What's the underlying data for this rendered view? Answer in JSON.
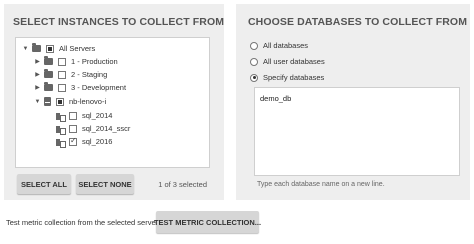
{
  "left_panel": {
    "title": "SELECT INSTANCES TO COLLECT FROM",
    "tree": [
      {
        "label": "All Servers",
        "toggle": "▼",
        "icon": "folder-icon",
        "check": "partial"
      },
      {
        "label": "1 - Production",
        "toggle": "▶",
        "icon": "folder-icon",
        "check": "unchecked"
      },
      {
        "label": "2 - Staging",
        "toggle": "▶",
        "icon": "folder-icon",
        "check": "unchecked"
      },
      {
        "label": "3 - Development",
        "toggle": "▶",
        "icon": "folder-icon",
        "check": "unchecked"
      },
      {
        "label": "nb-lenovo-i",
        "toggle": "▼",
        "icon": "server-icon",
        "check": "partial"
      },
      {
        "label": "sql_2014",
        "toggle": "",
        "icon": "database-icon",
        "check": "unchecked"
      },
      {
        "label": "sql_2014_sscr",
        "toggle": "",
        "icon": "database-icon",
        "check": "unchecked"
      },
      {
        "label": "sql_2016",
        "toggle": "",
        "icon": "database-icon",
        "check": "checked"
      }
    ],
    "select_all_label": "SELECT ALL",
    "select_none_label": "SELECT NONE",
    "selection_count": "1 of 3 selected"
  },
  "right_panel": {
    "title": "CHOOSE DATABASES TO COLLECT FROM",
    "options": [
      {
        "label": "All databases",
        "selected": false
      },
      {
        "label": "All user databases",
        "selected": false
      },
      {
        "label": "Specify databases",
        "selected": true
      }
    ],
    "databases_value": "demo_db",
    "hint": "Type each database name on a new line."
  },
  "footer": {
    "text": "Test metric collection from the selected servers",
    "test_button_label": "TEST METRIC COLLECTION..."
  }
}
